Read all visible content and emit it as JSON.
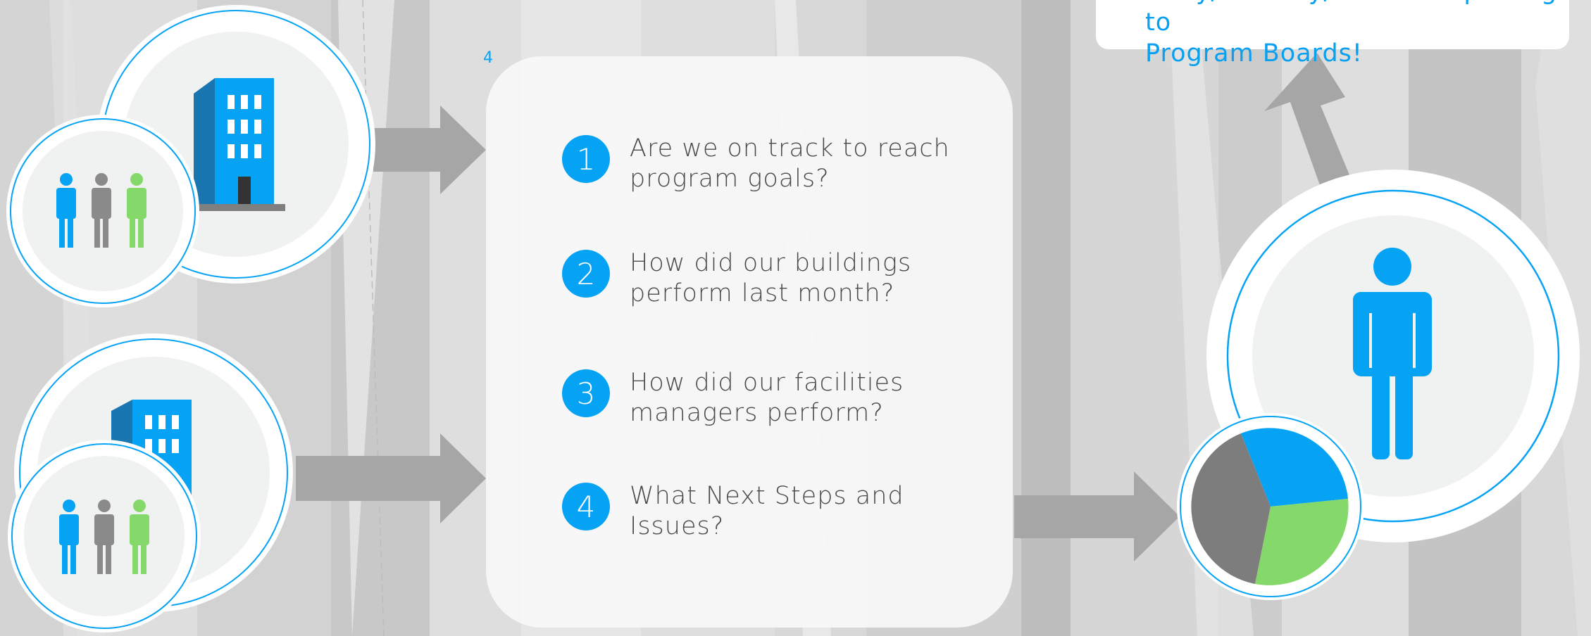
{
  "colors": {
    "accent_blue": "#06a3f5",
    "building_dark": "#1a76b0",
    "person_gray": "#8a8a8a",
    "person_green": "#85d86a",
    "arrow_gray": "#a6a6a6",
    "pie_gray": "#7d7d7d",
    "pie_green": "#85d86a",
    "text_gray": "#4a4a4a",
    "panel_white": "#f7f7f7"
  },
  "stray_mark": "4",
  "questions": [
    {
      "number": "1",
      "line1": "Are we on track to reach",
      "line2": "program goals?"
    },
    {
      "number": "2",
      "line1": "How did our buildings",
      "line2": "perform last month?"
    },
    {
      "number": "3",
      "line1": "How did our facilities",
      "line2": "managers perform?"
    },
    {
      "number": "4",
      "line1": "What Next Steps and",
      "line2": "Issues?"
    }
  ],
  "callout": {
    "line1": "Daily/Monthly/Annual Reporting to",
    "line2": "Program Boards!"
  },
  "icons": {
    "building": "building-icon",
    "people": "people-group-icon",
    "person": "person-icon",
    "pie": "pie-chart-icon",
    "arrow": "arrow-right-icon"
  }
}
